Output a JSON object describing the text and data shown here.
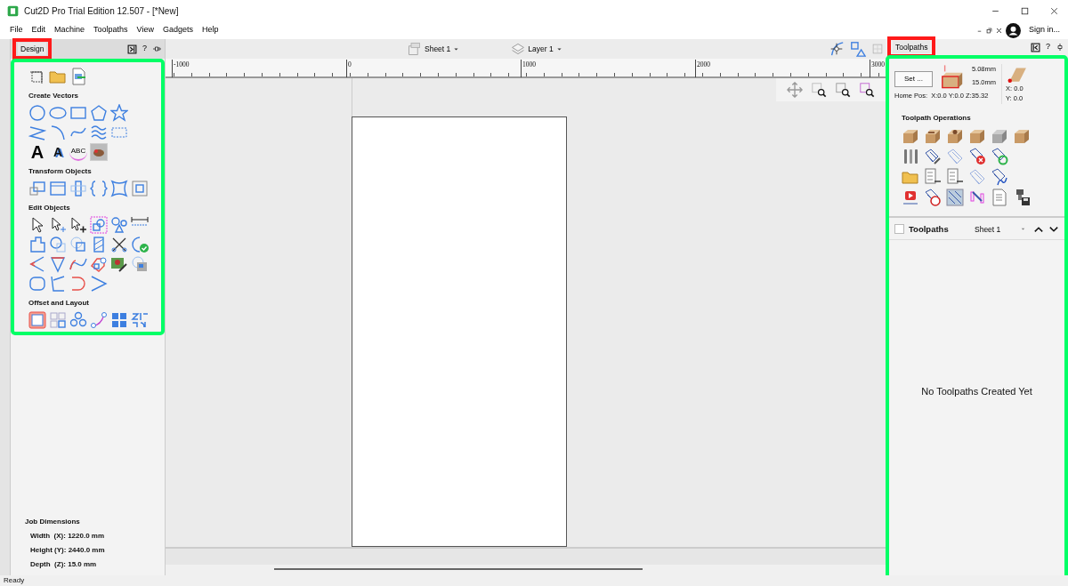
{
  "window": {
    "title": "Cut2D Pro Trial Edition 12.507 - [*New]"
  },
  "menu": [
    "File",
    "Edit",
    "Machine",
    "Toolpaths",
    "View",
    "Gadgets",
    "Help"
  ],
  "account": {
    "label": "Sign in..."
  },
  "design_panel": {
    "tab": "Design",
    "help": "?",
    "top_glyphs": [
      "A",
      "A",
      "ABC"
    ],
    "sections": [
      {
        "title": "Create Vectors"
      },
      {
        "title": "Transform Objects"
      },
      {
        "title": "Edit Objects"
      },
      {
        "title": "Offset and Layout"
      }
    ],
    "job_dimensions": {
      "title": "Job Dimensions",
      "lines": [
        "Width  (X): 1220.0 mm",
        "Height (Y): 2440.0 mm",
        "Depth  (Z): 15.0 mm"
      ]
    }
  },
  "canvas": {
    "sheet": "Sheet 1",
    "layer": "Layer 1",
    "ruler_labels": [
      "-1000",
      "0",
      "1000",
      "2000",
      "3000"
    ]
  },
  "toolpaths_panel": {
    "tab": "Toolpaths",
    "help": "?",
    "set_button": "Set ...",
    "material": {
      "gap": "5.08mm",
      "thickness": "15.0mm",
      "home_pos": "Home Pos:  X:0.0 Y:0.0 Z:35.32",
      "origin_x": "X: 0.0",
      "origin_y": "Y: 0.0"
    },
    "operations_title": "Toolpath Operations",
    "list": {
      "title": "Toolpaths",
      "checked": false,
      "sheet": "Sheet 1",
      "empty_message": "No Toolpaths Created Yet"
    }
  },
  "status_bar": {
    "text": "Ready"
  }
}
